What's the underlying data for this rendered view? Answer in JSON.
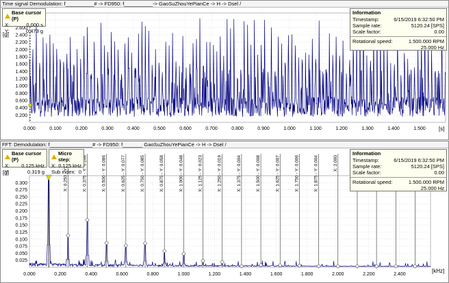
{
  "time_pane": {
    "title": "Time signal Demodulation: f__________# -> FD950: f__________-> GaoSuZhouYePianCe -> H -> Dsel  /",
    "cursor": {
      "title": "Base cursor (P)",
      "x_label": "X:",
      "x_value": "0.000 s",
      "y_label": "Y:",
      "y_value": "0.473 g"
    },
    "info": {
      "title": "Information",
      "rows": [
        {
          "label": "Timestamp:",
          "value": "6/15/2019 6:32:50 PM"
        },
        {
          "label": "Sample rate:",
          "value": "5120.24 [SPS]"
        },
        {
          "label": "Scale factor:",
          "value": "0.00"
        }
      ],
      "speed_label": "Rotational speed:",
      "speed_rpm": "1.500.000 RPM",
      "speed_hz": "25.000 Hz"
    },
    "y_unit": "[g]",
    "x_unit": "[s]",
    "y_ticks": [
      "2.800",
      "2.600",
      "2.400",
      "2.200",
      "2.000",
      "1.800",
      "1.600",
      "1.400",
      "1.200",
      "1.000",
      "0.800",
      "0.600",
      "0.400",
      "0.200"
    ],
    "x_ticks": [
      "0.000",
      "0.100",
      "0.200",
      "0.300",
      "0.400",
      "0.500",
      "0.600",
      "0.700",
      "0.800",
      "0.900",
      "1.000",
      "1.100",
      "1.200",
      "1.300",
      "1.400",
      "1.500"
    ]
  },
  "fft_pane": {
    "title": "FFT: Demodulation: f_______________# -> FD950: f_______ GaoSuZhouYePianCe -> H -> Dsel  /",
    "cursor": {
      "title": "Base cursor (P)",
      "x_label": "X:",
      "x_value": "0.125 kHz",
      "y_label": "Y:",
      "y_value": "0.319 g"
    },
    "micro": {
      "title": "Micro step:",
      "x_label": "X:",
      "x_value": "0.125 kHz",
      "sub_label": "Sub index:",
      "sub_value": "0"
    },
    "info": {
      "title": "Information",
      "rows": [
        {
          "label": "Timestamp:",
          "value": "6/15/2019 6:32:50 PM"
        },
        {
          "label": "Sample rate:",
          "value": "5120.24 [SPS]"
        },
        {
          "label": "Scale factor:",
          "value": "0.00"
        }
      ],
      "speed_label": "Rotational speed:",
      "speed_rpm": "1.500.000 RPM",
      "speed_hz": "25.000 Hz"
    },
    "y_unit": "[g]",
    "x_unit": "[kHz]",
    "y_ticks": [
      "0.300",
      "0.275",
      "0.250",
      "0.225",
      "0.200",
      "0.175",
      "0.150",
      "0.125",
      "0.100",
      "0.075",
      "0.050",
      "0.025"
    ],
    "x_ticks": [
      "0.000",
      "0.200",
      "0.400",
      "0.600",
      "0.800",
      "1.000",
      "1.200",
      "1.400",
      "1.600",
      "1.800",
      "2.000",
      "2.200",
      "2.400"
    ],
    "harmonic_labels": [
      "X: 0.250 - Y: 0.113",
      "X: 0.375 - Y: 0.168",
      "X: 0.500 - Y: 0.086",
      "X: 0.625 - Y: 0.077",
      "X: 0.750 - Y: 0.085",
      "X: 0.875 - Y: 0.058",
      "X: 1.000 - Y: 0.048",
      "X: 1.125 - Y: 0.023",
      "X: 1.250 - Y: 0.019",
      "X: 1.375 - Y: 0.004",
      "X: 1.500 - Y: 0.008",
      "X: 1.625 - Y: 0.007",
      "X: 1.750 - Y: 0.006",
      "X: 1.875 - Y: 0.004",
      "X: 2.000",
      "X: 2.125",
      "X: 2.250",
      "X: 2.375",
      "X: 2.500"
    ]
  },
  "chart_data": [
    {
      "type": "line",
      "title": "Time signal",
      "xlabel": "[s]",
      "ylabel": "[g]",
      "xlim": [
        0,
        1.6
      ],
      "ylim": [
        0,
        3.0
      ],
      "color": "#000080",
      "grid": true,
      "cursor_x": 0.0
    },
    {
      "type": "line",
      "title": "FFT",
      "xlabel": "[kHz]",
      "ylabel": "[g]",
      "xlim": [
        0,
        2.6
      ],
      "ylim": [
        0,
        0.325
      ],
      "color": "#000080",
      "grid": true,
      "cursor_x": 0.125,
      "harmonics": [
        {
          "x": 0.25,
          "y": 0.113
        },
        {
          "x": 0.375,
          "y": 0.168
        },
        {
          "x": 0.5,
          "y": 0.086
        },
        {
          "x": 0.625,
          "y": 0.077
        },
        {
          "x": 0.75,
          "y": 0.085
        },
        {
          "x": 0.875,
          "y": 0.058
        },
        {
          "x": 1.0,
          "y": 0.048
        },
        {
          "x": 1.125,
          "y": 0.023
        },
        {
          "x": 1.25,
          "y": 0.019
        },
        {
          "x": 1.375,
          "y": 0.004
        },
        {
          "x": 1.5,
          "y": 0.008
        },
        {
          "x": 1.625,
          "y": 0.007
        },
        {
          "x": 1.75,
          "y": 0.006
        },
        {
          "x": 1.875,
          "y": 0.004
        },
        {
          "x": 2.0,
          "y": 0.004
        },
        {
          "x": 2.125,
          "y": 0.004
        },
        {
          "x": 2.25,
          "y": 0.004
        },
        {
          "x": 2.375,
          "y": 0.004
        },
        {
          "x": 2.5,
          "y": 0.004
        }
      ],
      "peak": {
        "x": 0.125,
        "y": 0.319
      }
    }
  ]
}
